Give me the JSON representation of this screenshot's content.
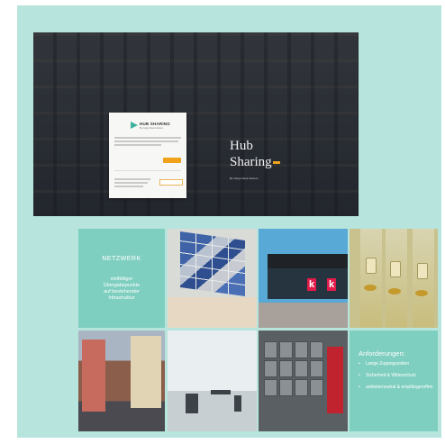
{
  "hero": {
    "title_line1": "Hub",
    "title_line2": "Sharing",
    "subtitle": "By Cargo Nova Ventum",
    "card": {
      "brand": "HUB SHARING",
      "brand_sub": "By Cargo Nova Ventum"
    }
  },
  "grid": {
    "netzwerk": {
      "heading": "NETZWERK",
      "body": [
        "vielfältiger",
        "Übergabepunkte",
        "auf bestehender",
        "Infrastruktur"
      ]
    },
    "anforderungen": {
      "heading": "Anforderungen:",
      "items": [
        "Lange Zugangszeiten",
        "Sicherheit & Witterschutz",
        "anbieterneutral & empfängeroffen"
      ]
    },
    "kiosk_letter": "k"
  },
  "colors": {
    "background": "#b7e5dd",
    "text_tile": "#7fcfc0",
    "accent": "#f0a21a"
  }
}
